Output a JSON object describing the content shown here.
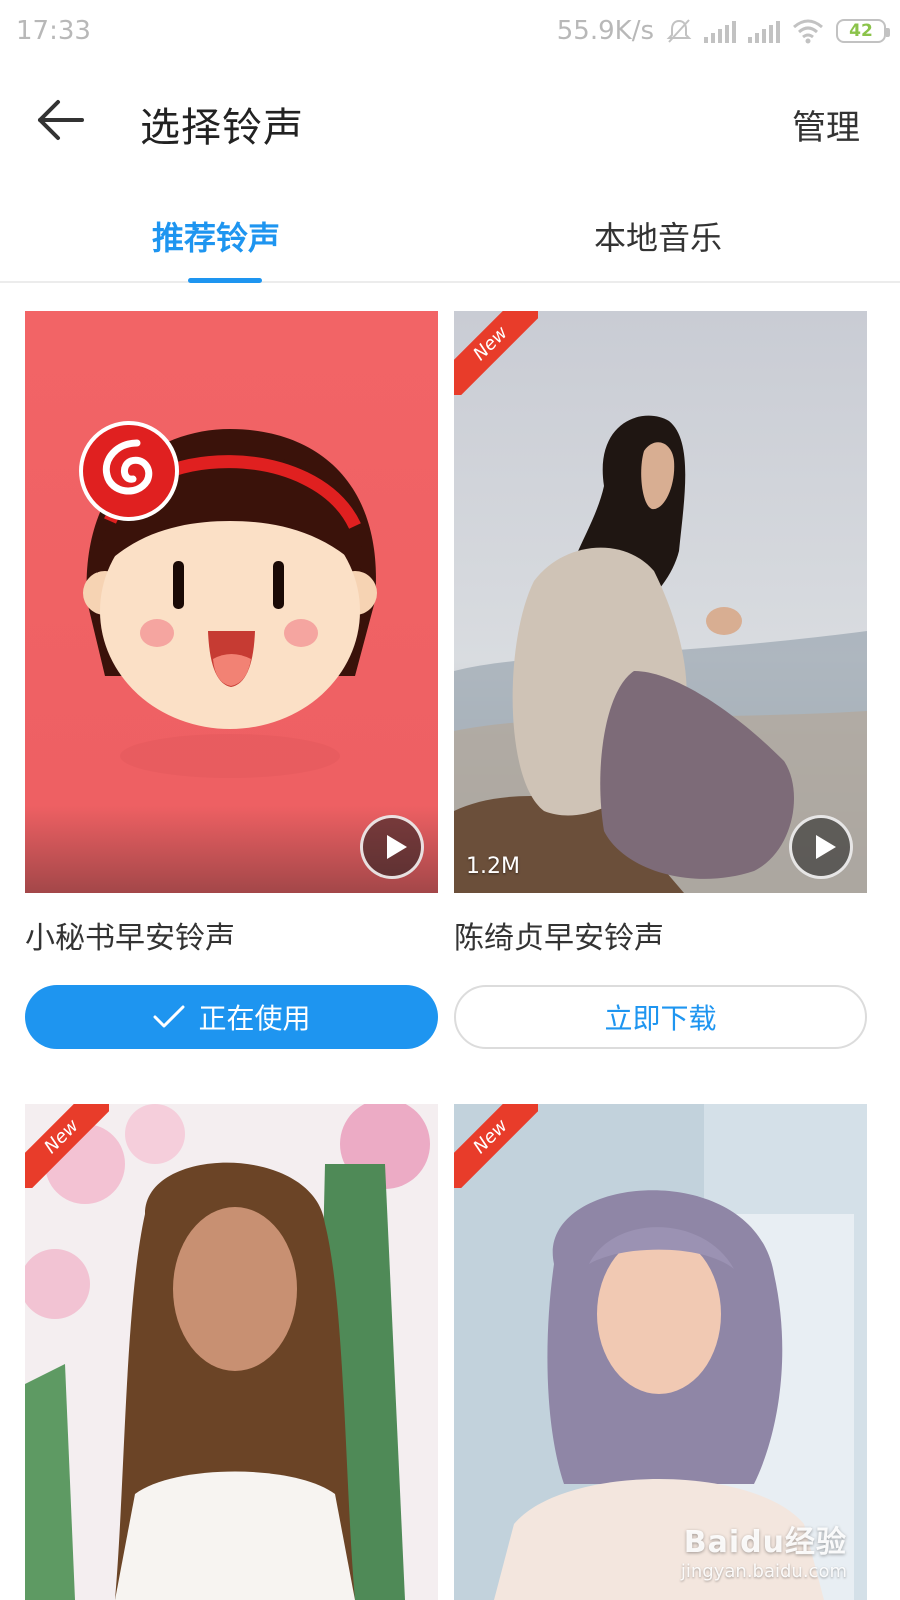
{
  "status_bar": {
    "time": "17:33",
    "net_speed": "55.9K/s",
    "battery": "42",
    "icons": [
      "mute-icon",
      "signal-icon",
      "signal-icon",
      "wifi-icon",
      "battery-icon"
    ]
  },
  "header": {
    "title": "选择铃声",
    "manage_label": "管理",
    "back_icon": "arrow-left-icon"
  },
  "tabs": [
    {
      "label": "推荐铃声",
      "active": true
    },
    {
      "label": "本地音乐",
      "active": false
    }
  ],
  "cards": [
    {
      "title": "小秘书早安铃声",
      "button": "正在使用",
      "state": "using",
      "is_new": false,
      "size": ""
    },
    {
      "title": "陈绮贞早安铃声",
      "button": "立即下载",
      "state": "download",
      "is_new": true,
      "size": "1.2M"
    },
    {
      "title": "",
      "button": "",
      "state": "",
      "is_new": true,
      "size": ""
    },
    {
      "title": "",
      "button": "",
      "state": "",
      "is_new": true,
      "size": ""
    }
  ],
  "badge_text": "New",
  "colors": {
    "accent": "#1e95f0",
    "new_badge": "#e83c2a",
    "card1_bg": "#f26466"
  },
  "watermark": {
    "main": "Baidu经验",
    "url": "jingyan.baidu.com"
  }
}
